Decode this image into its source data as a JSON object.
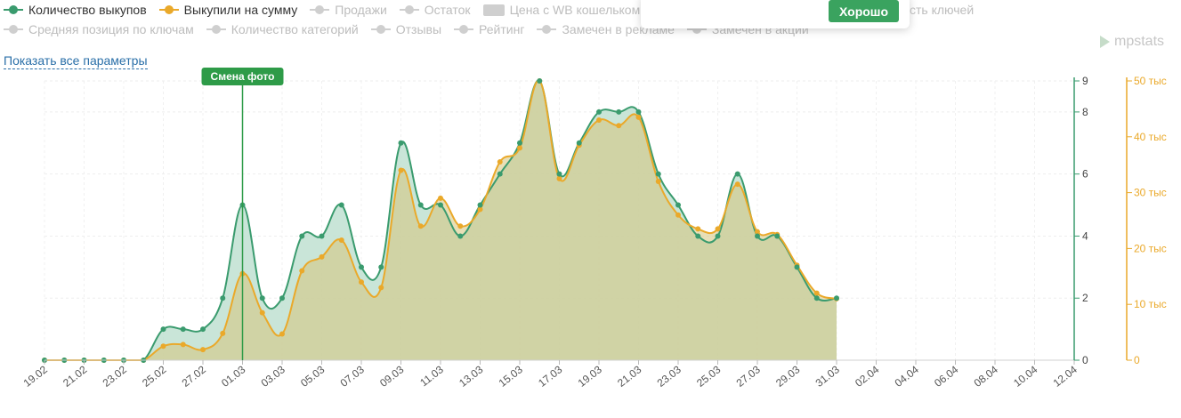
{
  "legend": {
    "row1": [
      {
        "label": "Количество выкупов",
        "state": "active-green",
        "icon": "line-dot-icon"
      },
      {
        "label": "Выкупили на сумму",
        "state": "active-orange",
        "icon": "line-dot-icon"
      },
      {
        "label": "Продажи",
        "state": "inactive",
        "icon": "line-dot-icon"
      },
      {
        "label": "Остаток",
        "state": "inactive",
        "icon": "line-dot-icon"
      },
      {
        "label": "Цена с WB кошельком",
        "state": "inactive",
        "icon": "swatch-icon"
      }
    ],
    "row1_tail": "сть ключей",
    "row2": [
      {
        "label": "Средняя позиция по ключам",
        "state": "inactive",
        "icon": "line-dot-icon"
      },
      {
        "label": "Количество категорий",
        "state": "inactive",
        "icon": "line-dot-icon"
      },
      {
        "label": "Отзывы",
        "state": "inactive",
        "icon": "line-dot-icon"
      },
      {
        "label": "Рейтинг",
        "state": "inactive",
        "icon": "line-dot-icon"
      },
      {
        "label": "Замечен в рекламе",
        "state": "inactive",
        "icon": "line-dot-icon"
      },
      {
        "label": "Замечен в акции",
        "state": "inactive",
        "icon": "line-dot-icon"
      }
    ]
  },
  "popup": {
    "ok_label": "Хорошо"
  },
  "brand": {
    "name": "mpstats",
    "icon": "mpstats-logo-icon"
  },
  "show_all_link": "Показать все параметры",
  "colors": {
    "green": "#3a9b6e",
    "green_fill": "#bfe0d1",
    "orange": "#eaa92a",
    "overlap_fill": "#cfd1a4",
    "marker": "#2e9b48"
  },
  "chart_data": {
    "type": "area",
    "x_tick_labels": [
      "19.02",
      "21.02",
      "23.02",
      "25.02",
      "27.02",
      "01.03",
      "03.03",
      "05.03",
      "07.03",
      "09.03",
      "11.03",
      "13.03",
      "15.03",
      "17.03",
      "19.03",
      "21.03",
      "23.03",
      "25.03",
      "27.03",
      "29.03",
      "31.03",
      "02.04",
      "04.04",
      "06.04",
      "08.04",
      "10.04",
      "12.04"
    ],
    "x_start": "19.02",
    "x_end": "12.04",
    "series": [
      {
        "name": "Количество выкупов",
        "axis": "left",
        "color": "#3a9b6e",
        "values": [
          0,
          0,
          0,
          0,
          0,
          0,
          1,
          1,
          1,
          2,
          5,
          2,
          2,
          4,
          4,
          5,
          3,
          3,
          7,
          5,
          5,
          4,
          5,
          6,
          7,
          9,
          6,
          7,
          8,
          8,
          8,
          6,
          5,
          4,
          4,
          6,
          4,
          4,
          3,
          2,
          2
        ]
      },
      {
        "name": "Выкупили на сумму",
        "axis": "right",
        "color": "#eaa92a",
        "values": [
          0,
          0,
          0,
          0,
          0,
          0,
          2500,
          2800,
          1900,
          4800,
          15500,
          8500,
          4700,
          16000,
          18500,
          21500,
          14000,
          13000,
          34000,
          24000,
          29000,
          24000,
          27000,
          35500,
          38000,
          50000,
          32500,
          38500,
          43000,
          42000,
          43500,
          32000,
          26000,
          23500,
          23500,
          31500,
          23000,
          22500,
          17000,
          12000,
          11000
        ]
      }
    ],
    "y_left": {
      "min": 0,
      "max": 9,
      "ticks": [
        "0",
        "2",
        "4",
        "6",
        "8",
        "9"
      ]
    },
    "y_right": {
      "min": 0,
      "max": 50000,
      "ticks": [
        "0",
        "10 тыс",
        "20 тыс",
        "30 тыс",
        "40 тыс",
        "50 тыс"
      ]
    },
    "annotation": {
      "label": "Смена фото",
      "date": "01.03"
    }
  }
}
